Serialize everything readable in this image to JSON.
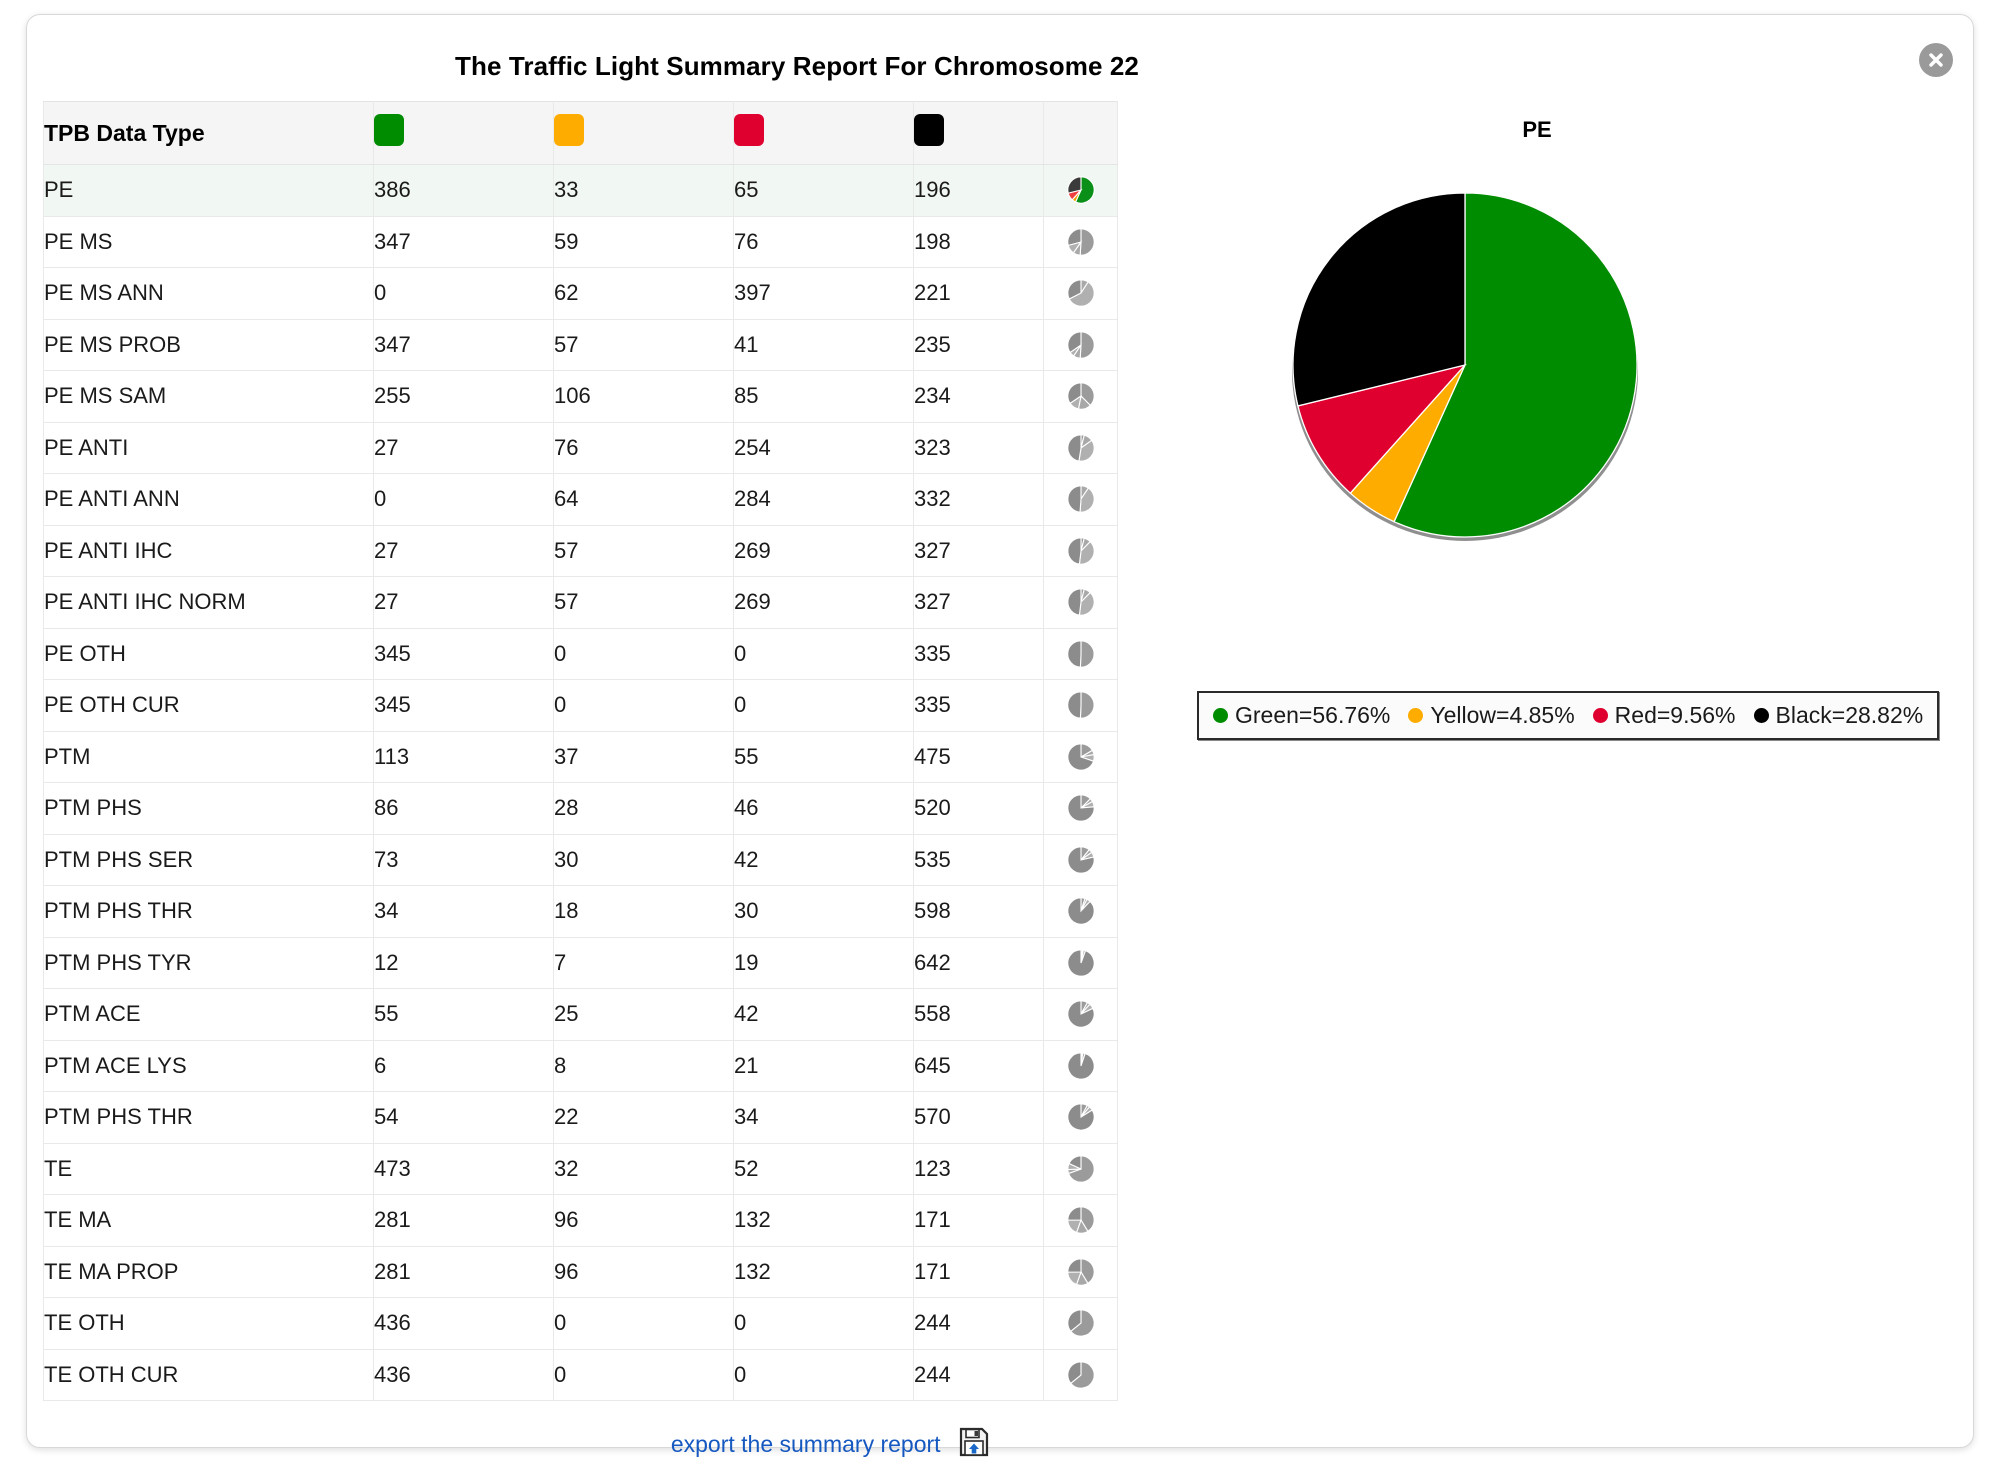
{
  "dialog": {
    "title": "The Traffic Light Summary Report For Chromosome 22",
    "close_icon": "close-icon"
  },
  "table": {
    "headers": {
      "label": "TPB Data Type",
      "green": "green-swatch",
      "yellow": "yellow-swatch",
      "red": "red-swatch",
      "black": "black-swatch",
      "pie": ""
    },
    "rows": [
      {
        "label": "PE",
        "green": "386",
        "yellow": "33",
        "red": "65",
        "black": "196",
        "active": true
      },
      {
        "label": "PE MS",
        "green": "347",
        "yellow": "59",
        "red": "76",
        "black": "198",
        "active": false
      },
      {
        "label": "PE MS ANN",
        "green": "0",
        "yellow": "62",
        "red": "397",
        "black": "221",
        "active": false
      },
      {
        "label": "PE MS PROB",
        "green": "347",
        "yellow": "57",
        "red": "41",
        "black": "235",
        "active": false
      },
      {
        "label": "PE MS SAM",
        "green": "255",
        "yellow": "106",
        "red": "85",
        "black": "234",
        "active": false
      },
      {
        "label": "PE ANTI",
        "green": "27",
        "yellow": "76",
        "red": "254",
        "black": "323",
        "active": false
      },
      {
        "label": "PE ANTI ANN",
        "green": "0",
        "yellow": "64",
        "red": "284",
        "black": "332",
        "active": false
      },
      {
        "label": "PE ANTI IHC",
        "green": "27",
        "yellow": "57",
        "red": "269",
        "black": "327",
        "active": false
      },
      {
        "label": "PE ANTI IHC NORM",
        "green": "27",
        "yellow": "57",
        "red": "269",
        "black": "327",
        "active": false
      },
      {
        "label": "PE OTH",
        "green": "345",
        "yellow": "0",
        "red": "0",
        "black": "335",
        "active": false
      },
      {
        "label": "PE OTH CUR",
        "green": "345",
        "yellow": "0",
        "red": "0",
        "black": "335",
        "active": false
      },
      {
        "label": "PTM",
        "green": "113",
        "yellow": "37",
        "red": "55",
        "black": "475",
        "active": false
      },
      {
        "label": "PTM PHS",
        "green": "86",
        "yellow": "28",
        "red": "46",
        "black": "520",
        "active": false
      },
      {
        "label": "PTM PHS SER",
        "green": "73",
        "yellow": "30",
        "red": "42",
        "black": "535",
        "active": false
      },
      {
        "label": "PTM PHS THR",
        "green": "34",
        "yellow": "18",
        "red": "30",
        "black": "598",
        "active": false
      },
      {
        "label": "PTM PHS TYR",
        "green": "12",
        "yellow": "7",
        "red": "19",
        "black": "642",
        "active": false
      },
      {
        "label": "PTM ACE",
        "green": "55",
        "yellow": "25",
        "red": "42",
        "black": "558",
        "active": false
      },
      {
        "label": "PTM ACE LYS",
        "green": "6",
        "yellow": "8",
        "red": "21",
        "black": "645",
        "active": false
      },
      {
        "label": "PTM PHS THR",
        "green": "54",
        "yellow": "22",
        "red": "34",
        "black": "570",
        "active": false
      },
      {
        "label": "TE",
        "green": "473",
        "yellow": "32",
        "red": "52",
        "black": "123",
        "active": false
      },
      {
        "label": "TE MA",
        "green": "281",
        "yellow": "96",
        "red": "132",
        "black": "171",
        "active": false
      },
      {
        "label": "TE MA PROP",
        "green": "281",
        "yellow": "96",
        "red": "132",
        "black": "171",
        "active": false
      },
      {
        "label": "TE OTH",
        "green": "436",
        "yellow": "0",
        "red": "0",
        "black": "244",
        "active": false
      },
      {
        "label": "TE OTH CUR",
        "green": "436",
        "yellow": "0",
        "red": "0",
        "black": "244",
        "active": false
      }
    ]
  },
  "export": {
    "label": "export the summary report",
    "icon": "save-export-icon"
  },
  "colors": {
    "green": "#008C00",
    "yellow": "#FFAC00",
    "red": "#E00030",
    "black": "#000000",
    "link": "#1558c0",
    "row_active_bg": "#f1f7f2"
  },
  "chart_data": {
    "type": "pie",
    "title": "PE",
    "labels": [
      "Green",
      "Yellow",
      "Red",
      "Black"
    ],
    "values": [
      56.76,
      4.85,
      9.56,
      28.82
    ],
    "counts": [
      386,
      33,
      65,
      196
    ],
    "colors": [
      "#008C00",
      "#FFAC00",
      "#E00030",
      "#000000"
    ],
    "legend": [
      {
        "label": "Green=56.76%",
        "color": "#008C00"
      },
      {
        "label": "Yellow=4.85%",
        "color": "#FFAC00"
      },
      {
        "label": "Red=9.56%",
        "color": "#E00030"
      },
      {
        "label": "Black=28.82%",
        "color": "#000000"
      }
    ],
    "legend_position": "below",
    "start_angle_deg": 0,
    "direction": "clockwise",
    "grid": false,
    "xlabel": "",
    "ylabel": ""
  }
}
